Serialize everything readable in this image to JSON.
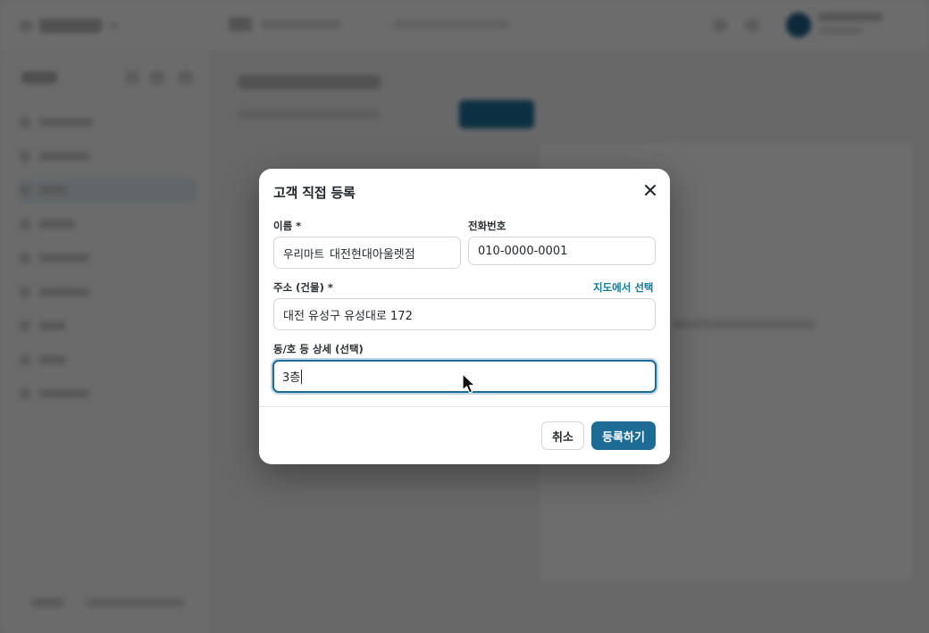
{
  "modal": {
    "title": "고객 직접 등록",
    "name_label": "이름 *",
    "name_prefix": "우리마트",
    "name_value": "대전현대아울렛점",
    "phone_label": "전화번호",
    "phone_value": "010-0000-0001",
    "address_label": "주소 (건물) *",
    "map_link": "지도에서 선택",
    "address_value": "대전 유성구 유성대로 172",
    "detail_label": "동/호 등 상세 (선택)",
    "detail_value": "3층",
    "cancel_label": "취소",
    "submit_label": "등록하기"
  },
  "icons": {
    "close": "close-icon",
    "cursor": "mouse-pointer-icon"
  },
  "colors": {
    "accent": "#1c6c96",
    "link": "#0f7a9a",
    "overlay": "rgba(0,0,0,0.56)"
  }
}
